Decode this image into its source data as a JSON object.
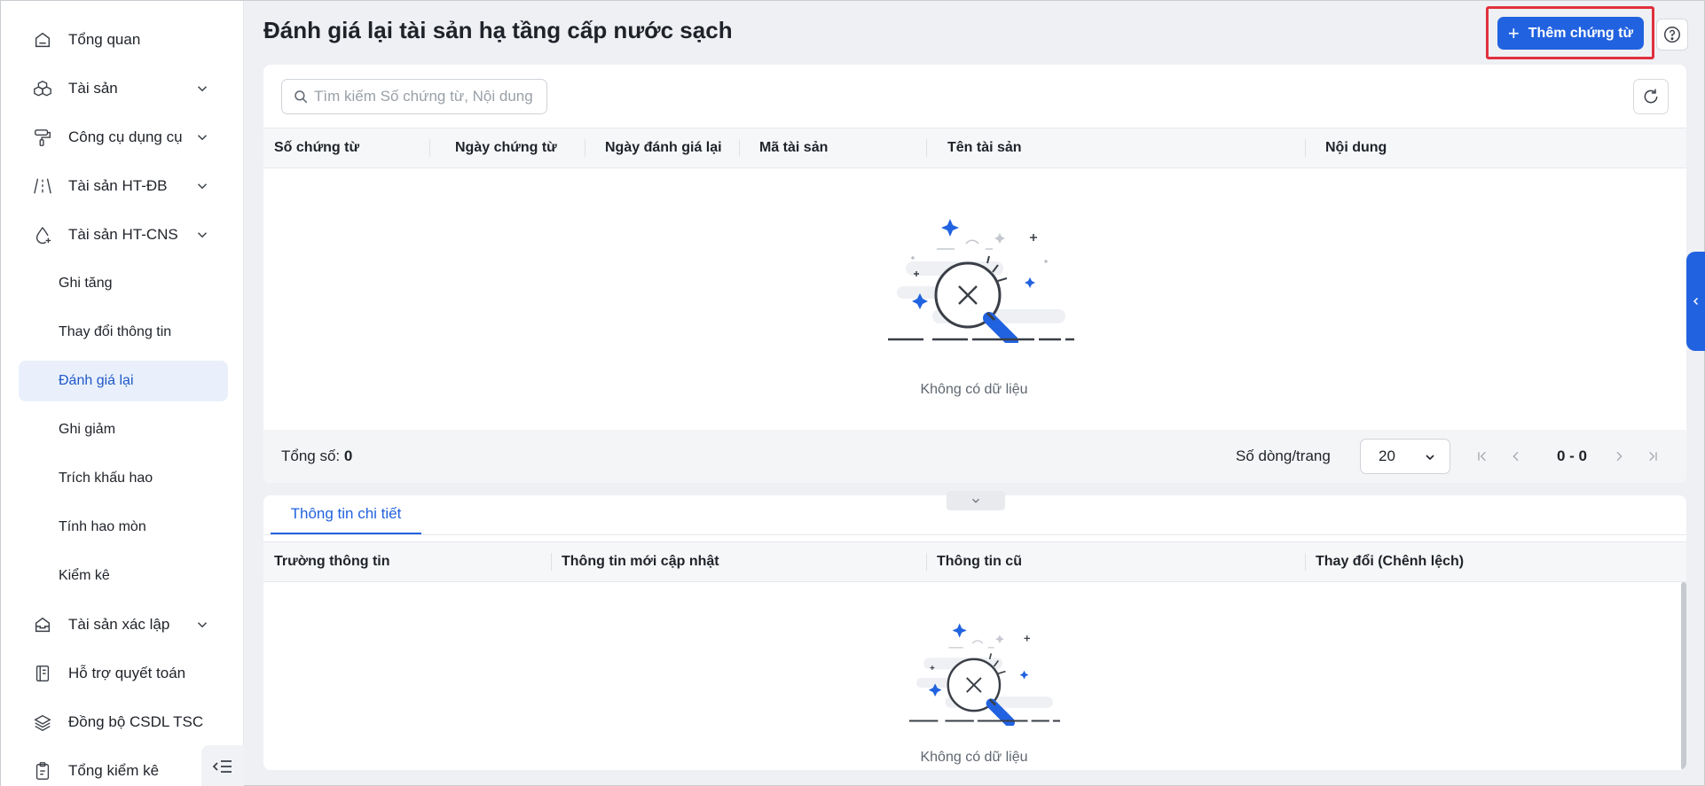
{
  "sidebar": {
    "items": [
      {
        "label": "Tổng quan",
        "icon": "home-icon"
      },
      {
        "label": "Tài sản",
        "icon": "cubes-icon"
      },
      {
        "label": "Công cụ dụng cụ",
        "icon": "paint-roller-icon"
      },
      {
        "label": "Tài sản HT-ĐB",
        "icon": "road-icon"
      },
      {
        "label": "Tài sản HT-CNS",
        "icon": "water-drop-icon"
      },
      {
        "label": "Tài sản xác lập",
        "icon": "inbox-icon"
      },
      {
        "label": "Hỗ trợ quyết toán",
        "icon": "ledger-icon"
      },
      {
        "label": "Đồng bộ CSDL TSC",
        "icon": "layers-icon"
      },
      {
        "label": "Tổng kiểm kê",
        "icon": "clipboard-icon"
      }
    ],
    "sub_items": [
      {
        "label": "Ghi tăng"
      },
      {
        "label": "Thay đổi thông tin"
      },
      {
        "label": "Đánh giá lại",
        "active": true
      },
      {
        "label": "Ghi giảm"
      },
      {
        "label": "Trích khấu hao"
      },
      {
        "label": "Tính hao mòn"
      },
      {
        "label": "Kiểm kê"
      }
    ]
  },
  "header": {
    "title": "Đánh giá lại tài sản hạ tầng cấp nước sạch",
    "add_button": "Thêm chứng từ"
  },
  "search": {
    "placeholder": "Tìm kiếm Số chứng từ, Nội dung",
    "value": ""
  },
  "main_table": {
    "columns": [
      "Số chứng từ",
      "Ngày chứng từ",
      "Ngày đánh giá lại",
      "Mã tài sản",
      "Tên tài sản",
      "Nội dung"
    ],
    "empty_text": "Không có dữ liệu",
    "rows": []
  },
  "pagination": {
    "total_label": "Tổng số:",
    "total_value": "0",
    "rows_per_page_label": "Số dòng/trang",
    "rows_per_page": "20",
    "range": "0 - 0"
  },
  "detail": {
    "tab_label": "Thông tin chi tiết",
    "columns": [
      "Trường thông tin",
      "Thông tin mới cập nhật",
      "Thông tin cũ",
      "Thay đổi (Chênh lệch)"
    ],
    "empty_text": "Không có dữ liệu"
  },
  "colors": {
    "accent": "#2162e0",
    "highlight_border": "#e0313d",
    "active_nav_bg": "#e9f0fc"
  }
}
